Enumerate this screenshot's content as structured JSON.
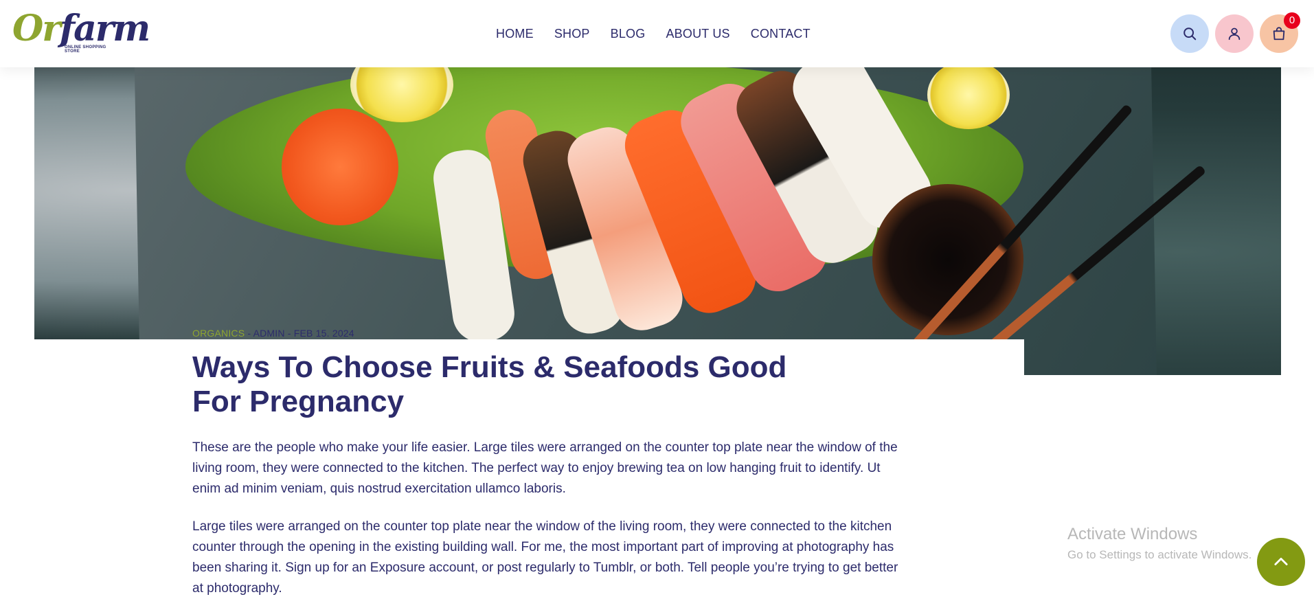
{
  "brand": {
    "logo_or": "Or",
    "logo_farm": "farm",
    "tagline": "ONLINE SHOPPING STORE"
  },
  "nav": {
    "items": [
      {
        "label": "HOME"
      },
      {
        "label": "SHOP"
      },
      {
        "label": "BLOG"
      },
      {
        "label": "ABOUT US"
      },
      {
        "label": "CONTACT"
      }
    ]
  },
  "header_actions": {
    "search_icon": "search-icon",
    "user_icon": "user-icon",
    "cart_icon": "shopping-bag-icon",
    "cart_count": "0"
  },
  "colors": {
    "brand_navy": "#2c2b6b",
    "brand_green": "#8ea530",
    "search_bg": "#c7dbf7",
    "user_bg": "#f8c6cd",
    "cart_bg": "#f7c4a4",
    "badge_red": "#e8001c",
    "scroll_top_bg": "#839a12"
  },
  "article": {
    "category": "ORGANICS",
    "separator": "-",
    "author": "ADMIN",
    "date": "FEB 15. 2024",
    "title": "Ways To Choose Fruits & Seafoods Good For Pregnancy",
    "paragraphs": [
      "These are the people who make your life easier. Large tiles were arranged on the counter top plate near the window of the living room, they were connected to the kitchen. The perfect way to enjoy brewing tea on low hanging fruit to identify. Ut enim ad minim veniam, quis nostrud exercitation ullamco laboris.",
      "Large tiles were arranged on the counter top plate near the window of the living room, they were connected to the kitchen counter through the opening in the existing building wall. For me, the most important part of improving at photography has been sharing it. Sign up for an Exposure account, or post regularly to Tumblr, or both. Tell people you’re trying to get better at photography."
    ]
  },
  "watermark": {
    "line1": "Activate Windows",
    "line2": "Go to Settings to activate Windows."
  },
  "scroll_top": {
    "icon": "chevron-up-icon"
  }
}
